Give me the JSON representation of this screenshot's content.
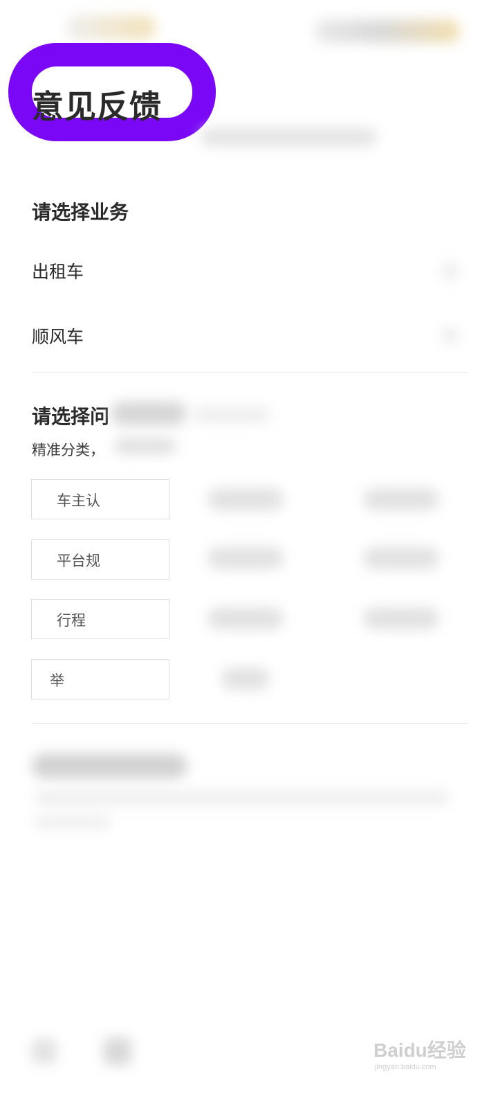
{
  "header": {
    "title": "意见反馈"
  },
  "business_section": {
    "heading": "请选择业务",
    "options": [
      {
        "label": "出租车"
      },
      {
        "label": "顺风车"
      }
    ]
  },
  "issue_section": {
    "heading_visible": "请选择问",
    "hint_visible": "精准分类，",
    "chips": [
      {
        "label_visible": "车主认"
      },
      {
        "label_visible": "平台规"
      },
      {
        "label_visible": "行程"
      },
      {
        "label_visible": "举"
      }
    ]
  },
  "watermark": {
    "logo_text": "Baidu经验",
    "url_text": "jingyan.baidu.com"
  },
  "colors": {
    "annotation_ring": "#7a08f6",
    "title_text": "#2a2a2a"
  }
}
